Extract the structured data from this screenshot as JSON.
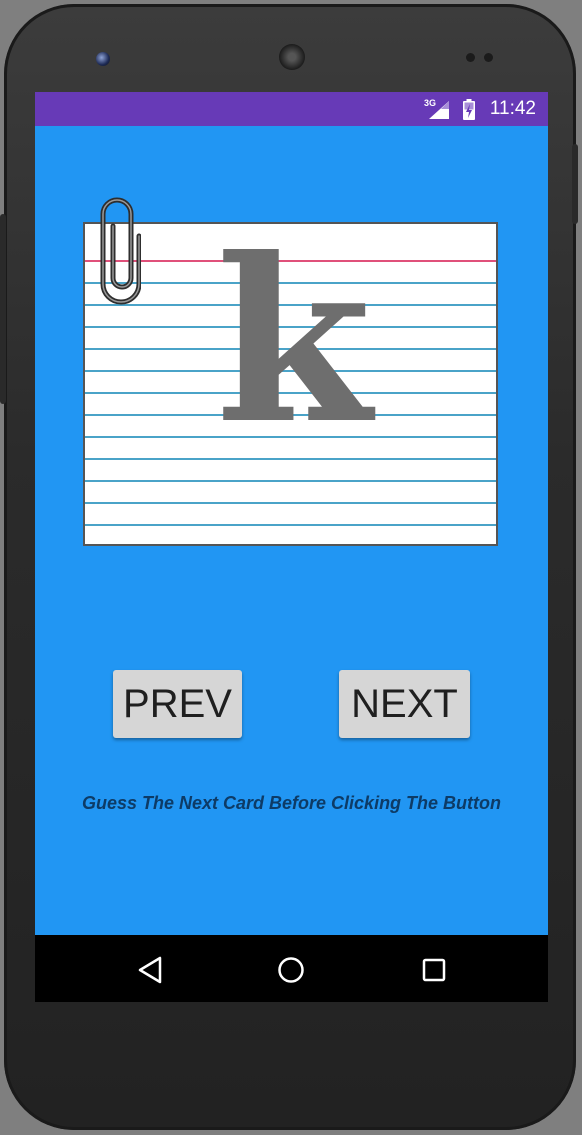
{
  "status_bar": {
    "network": "3G",
    "time": "11:42",
    "color": "#673ab7"
  },
  "card": {
    "letter": "k"
  },
  "buttons": {
    "prev_label": "PREV",
    "next_label": "NEXT"
  },
  "hint": "Guess The Next Card Before Clicking The Button",
  "nav_bar": {
    "back_icon": "back-triangle-icon",
    "home_icon": "home-circle-icon",
    "recents_icon": "recents-square-icon"
  },
  "colors": {
    "background": "#2196f3",
    "status_bar": "#673ab7",
    "card_rule": "#4aa3c8",
    "card_margin": "#e0507a",
    "letter": "#6e6e6e"
  }
}
